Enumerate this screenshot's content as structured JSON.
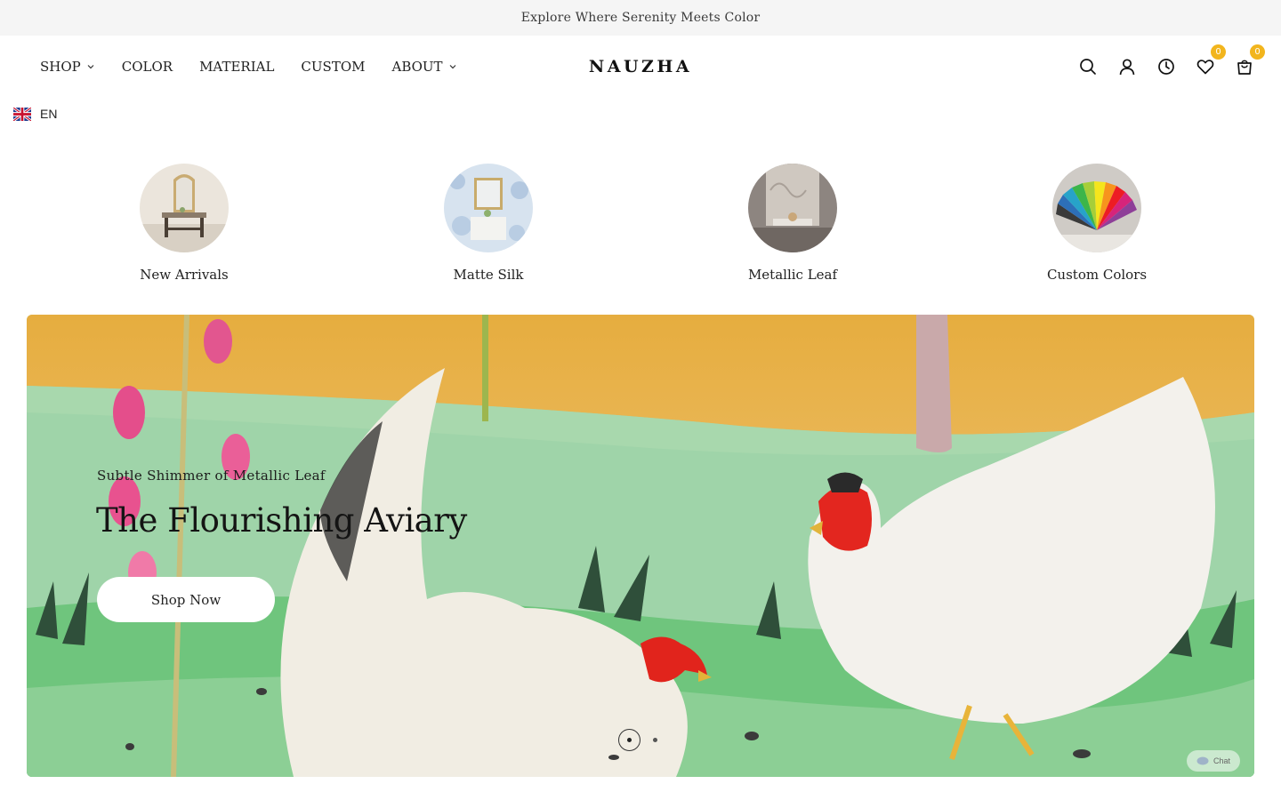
{
  "announcement": "Explore Where Serenity Meets Color",
  "brand": "NAUZHA",
  "nav": {
    "shop": "SHOP",
    "color": "COLOR",
    "material": "MATERIAL",
    "custom": "CUSTOM",
    "about": "ABOUT"
  },
  "icons": {
    "search": "search-icon",
    "account": "user-icon",
    "recent": "clock-icon",
    "wishlist": "heart-icon",
    "cart": "cart-icon",
    "wishlist_count": "0",
    "cart_count": "0",
    "badge_color": "#f2b51d"
  },
  "language": {
    "code": "EN"
  },
  "categories": [
    {
      "label": "New Arrivals"
    },
    {
      "label": "Matte Silk"
    },
    {
      "label": "Metallic Leaf"
    },
    {
      "label": "Custom Colors"
    }
  ],
  "hero": {
    "subtitle": "Subtle Shimmer of Metallic Leaf",
    "title": "The Flourishing Aviary",
    "button": "Shop Now",
    "slides_total": "2",
    "active_slide": "1"
  },
  "chat": {
    "label": "Chat"
  }
}
